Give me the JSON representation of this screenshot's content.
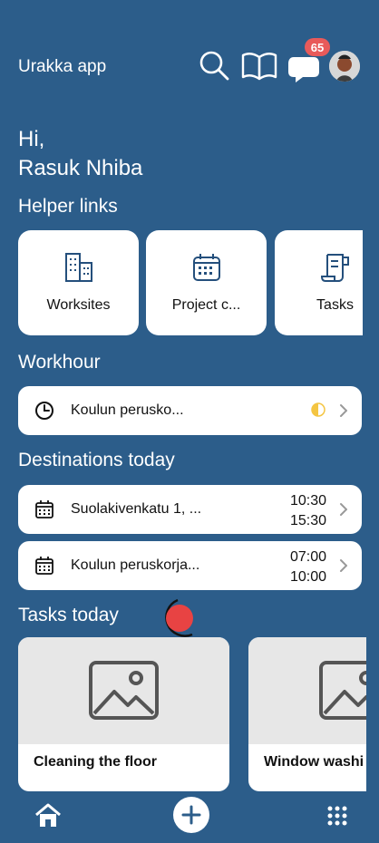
{
  "header": {
    "app_title": "Urakka app",
    "notification_count": "65",
    "icons": [
      "search-icon",
      "book-icon",
      "chat-icon",
      "avatar"
    ]
  },
  "greeting": {
    "hi": "Hi,",
    "name": "Rasuk Nhiba"
  },
  "helper_links": {
    "title": "Helper links",
    "items": [
      {
        "label": "Worksites",
        "icon": "building-icon"
      },
      {
        "label": "Project c...",
        "icon": "calendar-icon"
      },
      {
        "label": "Tasks",
        "icon": "document-icon"
      }
    ]
  },
  "workhour": {
    "title": "Workhour",
    "item": {
      "label": "Koulun perusko...",
      "icon": "clock-icon",
      "status_icon": "half-moon-icon"
    }
  },
  "destinations": {
    "title": "Destinations today",
    "items": [
      {
        "label": "Suolakivenkatu 1, ...",
        "start": "10:30",
        "end": "15:30",
        "icon": "calendar-icon"
      },
      {
        "label": "Koulun peruskorja...",
        "start": "07:00",
        "end": "10:00",
        "icon": "calendar-icon"
      }
    ]
  },
  "tasks": {
    "title": "Tasks today",
    "items": [
      {
        "title": "Cleaning the floor",
        "icon": "image-placeholder-icon"
      },
      {
        "title": "Window washi",
        "icon": "image-placeholder-icon"
      }
    ]
  },
  "bottom_nav": {
    "items": [
      "home-icon",
      "plus-icon",
      "grid-icon"
    ]
  },
  "colors": {
    "background": "#2c5d8a",
    "accent": "#e85a5a",
    "card": "#ffffff",
    "status_yellow": "#f4c542"
  }
}
